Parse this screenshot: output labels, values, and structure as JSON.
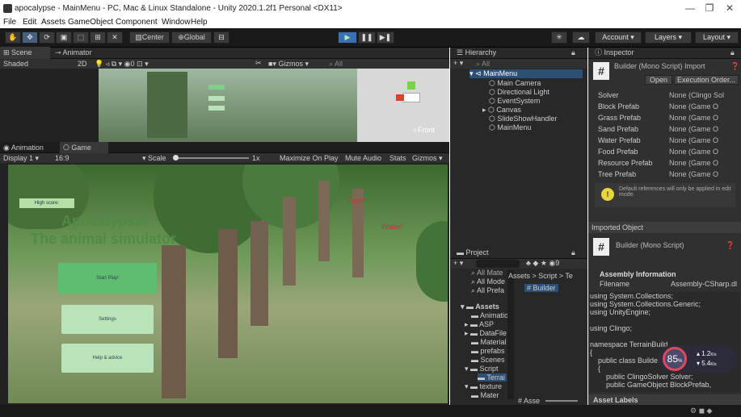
{
  "window": {
    "title": "apocalypse - MainMenu - PC, Mac & Linux Standalone - Unity 2020.1.2f1 Personal <DX11>",
    "minimize": "—",
    "maximize": "❐",
    "close": "✕"
  },
  "menu": [
    "File",
    "Edit",
    "Assets",
    "GameObject",
    "Component",
    "Window",
    "Help"
  ],
  "toolbar": {
    "center": "Center",
    "global": "Global",
    "account": "Account",
    "layers": "Layers",
    "layout": "Layout"
  },
  "scene": {
    "tab_scene": "Scene",
    "tab_animator": "Animator",
    "shading": "Shaded",
    "mode2d": "2D",
    "gizmos": "Gizmos",
    "search": "All",
    "front": "Front"
  },
  "game": {
    "tab_animation": "Animation",
    "tab_game": "Game",
    "display": "Display 1",
    "aspect": "16:9",
    "scale": "Scale",
    "scale_value": "1x",
    "maximize": "Maximize On Play",
    "mute": "Mute Audio",
    "stats": "Stats",
    "gizmos": "Gizmos"
  },
  "game_view": {
    "high_score": "High score:",
    "title1": "Apocalypse:",
    "title2": "The animal simulator",
    "start": "Start Play!",
    "settings": "Settings",
    "help": "Help & advice",
    "food": "Food!",
    "water": "Water!"
  },
  "hierarchy": {
    "title": "Hierarchy",
    "search": "All",
    "items": [
      "MainMenu",
      "Main Camera",
      "Directional Light",
      "EventSystem",
      "Canvas",
      "SlideShowHandler",
      "MainMenu"
    ]
  },
  "project": {
    "title": "Project",
    "favorites": [
      "All Mate",
      "All Mode",
      "All Prefa"
    ],
    "breadcrumb": "Assets > Script > Te",
    "file": "Builder",
    "folders": [
      "Assets",
      "Animatio",
      "ASP",
      "DataFile",
      "Material",
      "prefabs",
      "Scenes",
      "Script",
      "Terrai",
      "texture",
      "Mater"
    ],
    "bottom": "Asse"
  },
  "inspector": {
    "title": "Inspector",
    "component": "Builder (Mono Script) Import",
    "open": "Open",
    "exec": "Execution Order...",
    "fields": [
      {
        "label": "Solver",
        "value": "None (Clingo Sol"
      },
      {
        "label": "Block Prefab",
        "value": "None (Game O"
      },
      {
        "label": "Grass Prefab",
        "value": "None (Game O"
      },
      {
        "label": "Sand Prefab",
        "value": "None (Game O"
      },
      {
        "label": "Water Prefab",
        "value": "None (Game O"
      },
      {
        "label": "Food Prefab",
        "value": "None (Game O"
      },
      {
        "label": "Resource Prefab",
        "value": "None (Game O"
      },
      {
        "label": "Tree Prefab",
        "value": "None (Game O"
      }
    ],
    "warning": "Default references will only be applied in edit mode.",
    "imported": "Imported Object",
    "script_name": "Builder (Mono Script)",
    "assembly_info": "Assembly Information",
    "filename_label": "Filename",
    "filename_value": "Assembly-CSharp.dl",
    "code": [
      "using System.Collections;",
      "using System.Collections.Generic;",
      "using UnityEngine;",
      "",
      "using Clingo;",
      "",
      "namespace TerrainBuild",
      "{",
      "    public class Builder",
      "    {",
      "        public ClingoSolver Solver;",
      "        public GameObject BlockPrefab,"
    ],
    "asset_labels": "Asset Labels"
  },
  "overlay": {
    "percent": "85",
    "unit": "%",
    "up": "1.2",
    "up_unit": "K/s",
    "down": "5.4",
    "down_unit": "K/s"
  },
  "colors": {
    "accent": "#3b6fb6",
    "button_green": "#5ebd6f",
    "dark": "#191919"
  }
}
